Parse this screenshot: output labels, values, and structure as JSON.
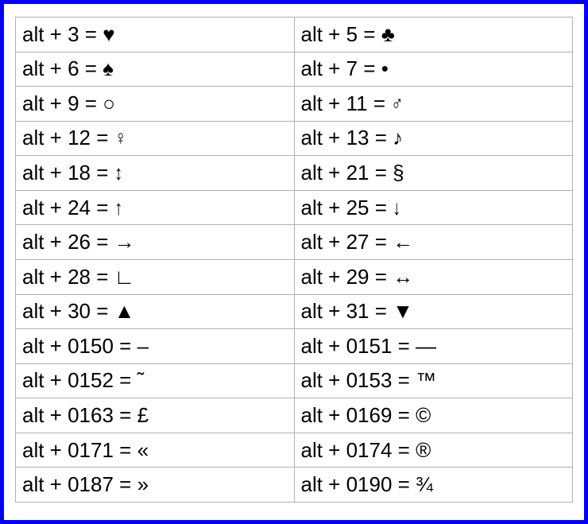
{
  "table": {
    "rows": [
      {
        "left": {
          "code": "3",
          "symbol": "♥"
        },
        "right": {
          "code": "5",
          "symbol": "♣"
        }
      },
      {
        "left": {
          "code": "6",
          "symbol": "♠"
        },
        "right": {
          "code": "7",
          "symbol": "•"
        }
      },
      {
        "left": {
          "code": "9",
          "symbol": "○"
        },
        "right": {
          "code": "11",
          "symbol": "♂"
        }
      },
      {
        "left": {
          "code": "12",
          "symbol": "♀"
        },
        "right": {
          "code": "13",
          "symbol": "♪"
        }
      },
      {
        "left": {
          "code": "18",
          "symbol": "↕"
        },
        "right": {
          "code": "21",
          "symbol": "§"
        }
      },
      {
        "left": {
          "code": "24",
          "symbol": "↑"
        },
        "right": {
          "code": "25",
          "symbol": "↓"
        }
      },
      {
        "left": {
          "code": "26",
          "symbol": "→"
        },
        "right": {
          "code": "27",
          "symbol": "←"
        }
      },
      {
        "left": {
          "code": "28",
          "symbol": "∟"
        },
        "right": {
          "code": "29",
          "symbol": "↔"
        }
      },
      {
        "left": {
          "code": "30",
          "symbol": "▲"
        },
        "right": {
          "code": "31",
          "symbol": "▼"
        }
      },
      {
        "left": {
          "code": "0150",
          "symbol": "–"
        },
        "right": {
          "code": "0151",
          "symbol": "—"
        }
      },
      {
        "left": {
          "code": "0152",
          "symbol": "˜"
        },
        "right": {
          "code": "0153",
          "symbol": "™"
        }
      },
      {
        "left": {
          "code": "0163",
          "symbol": "£"
        },
        "right": {
          "code": "0169",
          "symbol": "©"
        }
      },
      {
        "left": {
          "code": "0171",
          "symbol": "«"
        },
        "right": {
          "code": "0174",
          "symbol": "®"
        }
      },
      {
        "left": {
          "code": "0187",
          "symbol": "»"
        },
        "right": {
          "code": "0190",
          "symbol": "¾"
        }
      }
    ],
    "prefix": "alt + ",
    "separator": " = "
  }
}
